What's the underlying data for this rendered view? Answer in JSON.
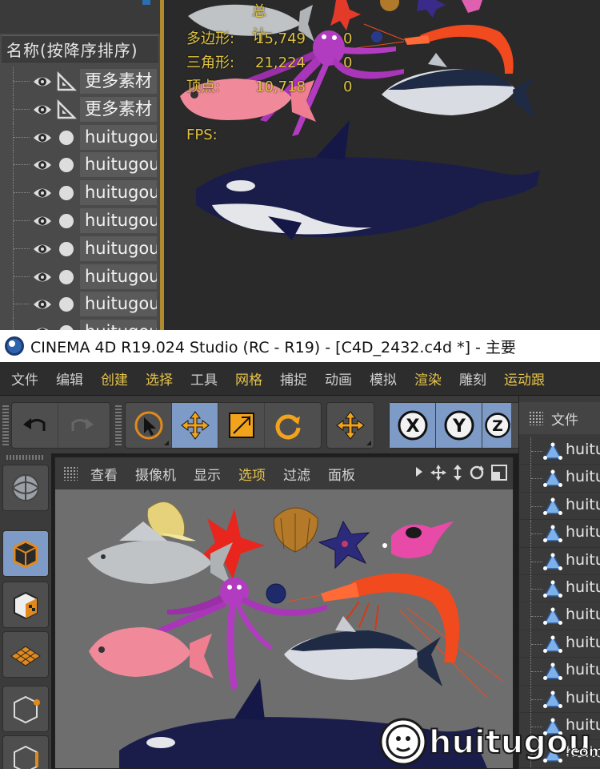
{
  "stats_hud": {
    "title": "总计",
    "rows": [
      {
        "label": "多边形:",
        "value": "15,749",
        "selected": "0"
      },
      {
        "label": "三角形:",
        "value": "21,224",
        "selected": "0"
      },
      {
        "label": "顶点:",
        "value": "10,718",
        "selected": "0"
      }
    ],
    "fps_label": "FPS:"
  },
  "object_manager": {
    "header": "名称(按降序排序)",
    "rows": [
      {
        "name": "更多素材",
        "icon": "triangle-ruler-icon"
      },
      {
        "name": "更多素材",
        "icon": "triangle-ruler-icon"
      },
      {
        "name": "huitugou",
        "icon": "null-dot-icon"
      },
      {
        "name": "huitugou",
        "icon": "null-dot-icon"
      },
      {
        "name": "huitugou",
        "icon": "null-dot-icon"
      },
      {
        "name": "huitugou",
        "icon": "null-dot-icon"
      },
      {
        "name": "huitugou",
        "icon": "null-dot-icon"
      },
      {
        "name": "huitugou",
        "icon": "null-dot-icon"
      },
      {
        "name": "huitugou",
        "icon": "null-dot-icon"
      },
      {
        "name": "huitugou",
        "icon": "null-dot-icon"
      }
    ]
  },
  "window": {
    "title": "CINEMA 4D R19.024 Studio (RC - R19) - [C4D_2432.c4d *] - 主要"
  },
  "menubar": {
    "items": [
      {
        "label": "文件",
        "highlight": false
      },
      {
        "label": "编辑",
        "highlight": false
      },
      {
        "label": "创建",
        "highlight": true
      },
      {
        "label": "选择",
        "highlight": true
      },
      {
        "label": "工具",
        "highlight": false
      },
      {
        "label": "网格",
        "highlight": true
      },
      {
        "label": "捕捉",
        "highlight": false
      },
      {
        "label": "动画",
        "highlight": false
      },
      {
        "label": "模拟",
        "highlight": false
      },
      {
        "label": "渲染",
        "highlight": true
      },
      {
        "label": "雕刻",
        "highlight": false
      },
      {
        "label": "运动跟",
        "highlight": true
      }
    ]
  },
  "toolbar": {
    "undo_icon": "undo-icon",
    "redo_icon": "redo-icon",
    "select_icon": "live-select-icon",
    "move_icon": "move-icon",
    "scale_icon": "scale-icon",
    "rotate_icon": "rotate-icon",
    "axis_x": "X",
    "axis_y": "Y",
    "axis_z": "Z"
  },
  "viewport": {
    "menu": [
      {
        "label": "查看",
        "highlight": false
      },
      {
        "label": "摄像机",
        "highlight": false
      },
      {
        "label": "显示",
        "highlight": false
      },
      {
        "label": "选项",
        "highlight": true
      },
      {
        "label": "过滤",
        "highlight": false
      },
      {
        "label": "面板",
        "highlight": false
      }
    ]
  },
  "right_panel": {
    "header": "文件",
    "rows": [
      "huitu",
      "huitu",
      "huitu",
      "huitu",
      "huitu",
      "huitu",
      "huitu",
      "huitu",
      "huitu",
      "huitu",
      "huitu",
      "huitu"
    ]
  },
  "watermark": {
    "brand": "huitugou",
    "suffix": ".com"
  },
  "colors": {
    "accent_blue": "#7d9bc6",
    "menu_highlight": "#e4c24a",
    "hud_text": "#e0c341",
    "selection_orange": "#e08a1e"
  }
}
